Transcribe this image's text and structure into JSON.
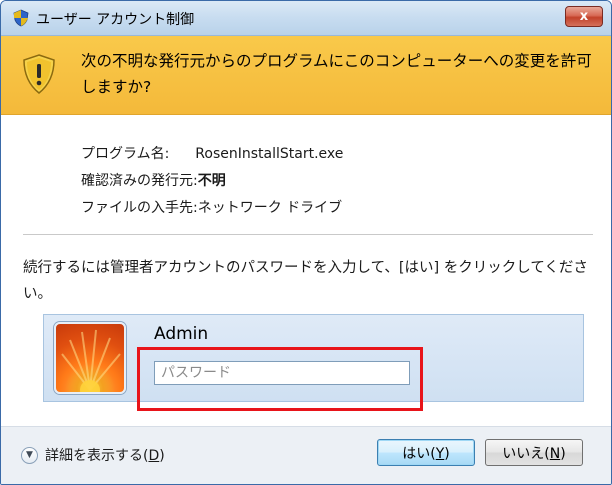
{
  "window": {
    "title": "ユーザー アカウント制御",
    "close_label": "x"
  },
  "banner": {
    "message": "次の不明な発行元からのプログラムにこのコンピューターへの変更を許可しますか?"
  },
  "details": {
    "program_key": "プログラム名:",
    "program_value": "RosenInstallStart.exe",
    "publisher_key": "確認済みの発行元:",
    "publisher_value": "不明",
    "origin_key": "ファイルの入手先:",
    "origin_value": "ネットワーク ドライブ"
  },
  "instruction": "続行するには管理者アカウントのパスワードを入力して、[はい] をクリックしてください。",
  "credential": {
    "username": "Admin",
    "password_placeholder": "パスワード",
    "password_value": ""
  },
  "footer": {
    "details_label": "詳細を表示する",
    "details_accel": "D",
    "yes_label": "はい",
    "yes_accel": "Y",
    "no_label": "いいえ",
    "no_accel": "N"
  },
  "colors": {
    "banner": "#f4b93a",
    "highlight": "#e8141a",
    "titlebar": "#c7dcf0"
  }
}
